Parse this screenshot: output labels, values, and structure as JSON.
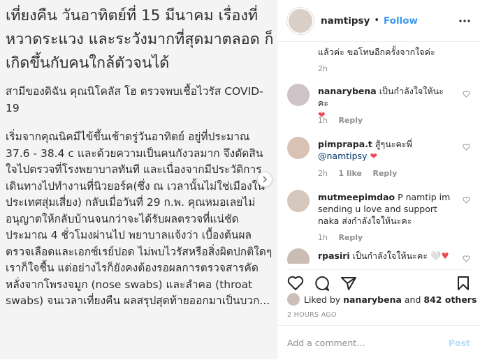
{
  "post": {
    "headline": "เที่ยงคืน วันอาทิตย์ที่ 15 มีนาคม เรื่องที่หวาดระแวง และระวังมากที่สุดมาตลอด ก็เกิดขึ้นกับคนใกล้ตัวจนได้",
    "p1": "สามีของดิฉัน คุณนิโคลัส โฮ ตรวจพบเชื้อไวรัส COVID-19",
    "p2": "เริ่มจากคุณนิคมีไข้ขึ้นเช้าตรู่วันอาทิตย์ อยู่ที่ประมาณ 37.6 - 38.4 c และด้วยความเป็นคนกังวลมาก จึงตัดสินใจไปตรวจที่โรงพยาบาลทันที และเนื่องจากมีประวัติการเดินทางไปทำงานที่นิวยอร์ค(ซึ่ง ณ เวลานั้นไม่ใช่เมืองในประเทศสุ่มเสี่ยง) กลับเมื่อวันที่ 29 ก.พ. คุณหมอเลยไม่อนุญาตให้กลับบ้านจนกว่าจะได้รับผลตรวจที่แน่ชัด",
    "p3": "ประมาณ 4 ชั่วโมงผ่านไป พยาบาลแจ้งว่า เบื้องต้นผลตรวจเลือดและเอกซ์เรย์ปอด ไม่พบไวรัสหรือสิ่งผิดปกติใดๆ เราก็ใจชื้น แต่อย่างไรก็ยังคงต้องรอผลการตรวจสารคัดหลั่งจากโพรงจมูก (nose swabs) และลำคอ (throat swabs) จนเวลาเที่ยงคืน ผลสรุปสุดท้ายออกมาเป็นบวก..."
  },
  "header": {
    "username": "namtipsy",
    "dot": "•",
    "follow": "Follow"
  },
  "comments": [
    {
      "text": "แล้วค่ะ ขอโทษอีกครั้งจากใจค่ะ",
      "time": "2h"
    },
    {
      "user": "nanarybena",
      "text": "เป็นกำลังใจให้นะคะ",
      "time": "1h",
      "reply": "Reply"
    },
    {
      "user": "pimprapa.t",
      "text": "สู้ๆนะคะพี่",
      "mention": "@namtipsy",
      "time": "2h",
      "likes": "1 like",
      "reply": "Reply"
    },
    {
      "user": "mutmeepimdao",
      "text": "P namtip im sending u love and support naka ส่งกำลังใจให้นะคะ",
      "time": "1h",
      "reply": "Reply"
    },
    {
      "user": "rpasiri",
      "text": "เป็นกำลังใจให้นะคะ",
      "emoji": "🤍♥"
    }
  ],
  "likes": {
    "prefix": "Liked by",
    "user": "nanarybena",
    "and": "and",
    "others": "842 others"
  },
  "time_ago": "2 HOURS AGO",
  "add_comment": {
    "placeholder": "Add a comment…",
    "post": "Post"
  }
}
